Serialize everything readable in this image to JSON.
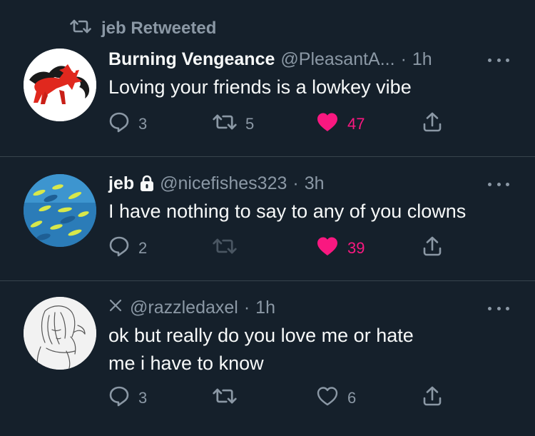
{
  "retweet_banner": {
    "text": "jeb Retweeted"
  },
  "tweets": [
    {
      "name": "Burning Vengeance",
      "handle": "@PleasantA...",
      "separator": "·",
      "time": "1h",
      "text": "Loving your friends is a lowkey vibe",
      "replies": "3",
      "retweets": "5",
      "likes": "47",
      "liked": true,
      "avatar_icon": "red-pony-avatar"
    },
    {
      "name": "jeb",
      "protected": true,
      "handle": "@nicefishes323",
      "separator": "·",
      "time": "3h",
      "text": "I have nothing to say to any of you clowns",
      "replies": "2",
      "retweets": "",
      "likes": "39",
      "liked": true,
      "avatar_icon": "fish-school-avatar"
    },
    {
      "name": "",
      "name_icon": "x-mark-icon",
      "handle": "@razzledaxel",
      "separator": "·",
      "time": "1h",
      "text": "ok but really do you love me or hate me i have to know",
      "replies": "3",
      "retweets": "",
      "likes": "6",
      "liked": false,
      "avatar_icon": "sketch-portrait-avatar"
    }
  ],
  "colors": {
    "background": "#15202b",
    "divider": "#38444d",
    "muted": "#8b98a5",
    "like_active": "#f91880",
    "text": "#f7f9f9"
  }
}
